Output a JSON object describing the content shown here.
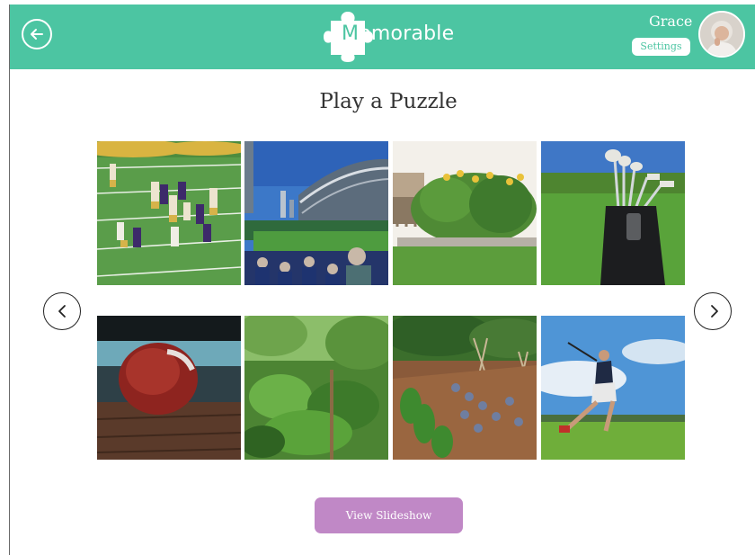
{
  "header": {
    "app_name_prefix": "M",
    "app_name_suffix": "emorable",
    "user_name": "Grace",
    "settings_label": "Settings",
    "accent_color": "#4cc5a2"
  },
  "main": {
    "title": "Play a Puzzle",
    "puzzles": [
      {
        "subject": "football-players"
      },
      {
        "subject": "stadium"
      },
      {
        "subject": "sunflower-garden"
      },
      {
        "subject": "golf-bag"
      },
      {
        "subject": "football"
      },
      {
        "subject": "leafy-garden"
      },
      {
        "subject": "vegetable-garden"
      },
      {
        "subject": "golfer-swing"
      }
    ],
    "slideshow_label": "View Slideshow",
    "slideshow_color": "#c088c6"
  },
  "icons": [
    "back-arrow-icon",
    "puzzle-piece-icon",
    "chevron-left-icon",
    "chevron-right-icon"
  ]
}
